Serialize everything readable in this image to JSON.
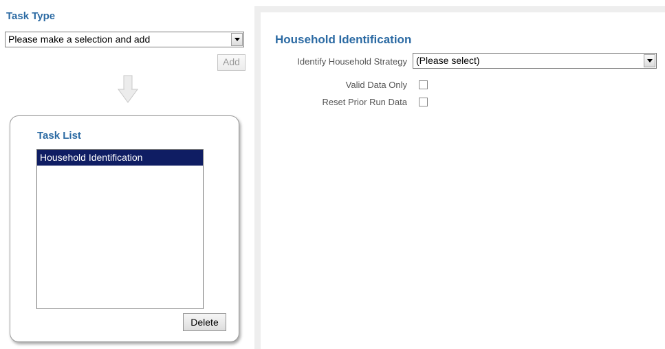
{
  "task_type": {
    "heading": "Task Type",
    "select_value": "Please make a selection and add",
    "add_label": "Add"
  },
  "task_list": {
    "heading": "Task List",
    "items": [
      {
        "label": "Household Identification",
        "selected": true
      }
    ],
    "delete_label": "Delete"
  },
  "detail": {
    "heading": "Household Identification",
    "strategy_label": "Identify Household Strategy",
    "strategy_value": "(Please select)",
    "valid_label": "Valid Data Only",
    "valid_checked": false,
    "reset_label": "Reset Prior Run Data",
    "reset_checked": false
  },
  "colors": {
    "heading": "#2b6aa3",
    "selection": "#0f1d63"
  },
  "icons": {
    "arrow": "down-arrow-icon",
    "dropdown": "chevron-down-icon"
  }
}
